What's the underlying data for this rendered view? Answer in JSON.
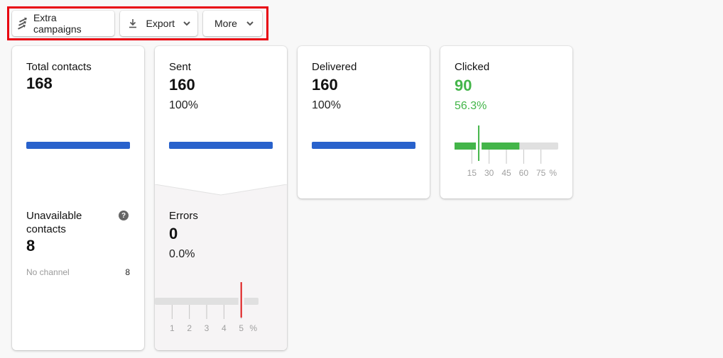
{
  "toolbar": {
    "extra_campaigns": {
      "label": "Extra campaigns",
      "icon": "extra-campaigns-icon"
    },
    "export": {
      "label": "Export",
      "icon": "download-icon"
    },
    "more": {
      "label": "More"
    }
  },
  "cards": {
    "total_contacts": {
      "label": "Total contacts",
      "value": "168",
      "bar_fraction": 1.0
    },
    "unavailable_contacts": {
      "label_line1": "Unavailable",
      "label_line2": "contacts",
      "value": "8",
      "help_icon": "?",
      "breakdown": [
        {
          "label": "No channel",
          "value": "8"
        }
      ]
    },
    "sent": {
      "label": "Sent",
      "value": "160",
      "percent": "100%",
      "bar_fraction": 1.0
    },
    "errors": {
      "label": "Errors",
      "value": "0",
      "percent": "0.0%",
      "gauge": {
        "value_percent": 0.0,
        "max_percent": 6,
        "threshold_percent": 5,
        "ticks": [
          "1",
          "2",
          "3",
          "4",
          "5"
        ],
        "tick_values": [
          1,
          2,
          3,
          4,
          5
        ],
        "unit": "%",
        "threshold_color": "#dd1a1a"
      }
    },
    "delivered": {
      "label": "Delivered",
      "value": "160",
      "percent": "100%",
      "bar_fraction": 1.0
    },
    "clicked": {
      "label": "Clicked",
      "value": "90",
      "percent": "56.3%",
      "gauge": {
        "value_percent": 56.3,
        "max_percent": 90,
        "benchmark_percent": 21,
        "ticks": [
          "15",
          "30",
          "45",
          "60",
          "75"
        ],
        "tick_values": [
          15,
          30,
          45,
          60,
          75
        ],
        "unit": "%",
        "fill_color": "#43b549"
      }
    }
  },
  "colors": {
    "accent_blue": "#2962cc",
    "success_green": "#43b549",
    "error_red": "#dd1a1a",
    "highlight_border": "#e8000f"
  }
}
